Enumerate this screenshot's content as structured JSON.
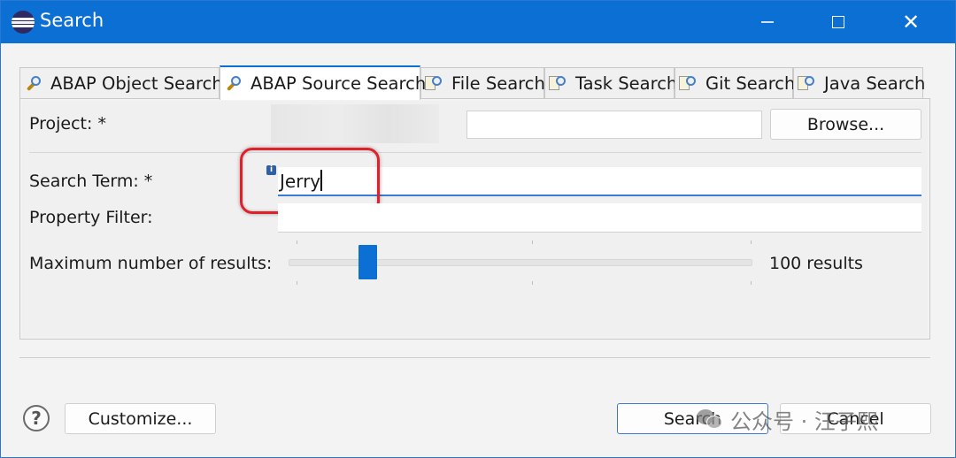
{
  "window": {
    "title": "Search",
    "close_glyph": "✕"
  },
  "tabs": [
    {
      "label": "ABAP Object Search",
      "icon": "abap-object-search-icon",
      "active": false
    },
    {
      "label": "ABAP Source Search",
      "icon": "abap-source-search-icon",
      "active": true
    },
    {
      "label": "File Search",
      "icon": "file-search-icon",
      "active": false
    },
    {
      "label": "Task Search",
      "icon": "task-search-icon",
      "active": false
    },
    {
      "label": "Git Search",
      "icon": "git-search-icon",
      "active": false
    },
    {
      "label": "Java Search",
      "icon": "java-search-icon",
      "active": false
    }
  ],
  "form": {
    "project_label": "Project: *",
    "project_value": "",
    "browse_label": "Browse...",
    "search_term_label": "Search Term: *",
    "search_term_value": "Jerry",
    "info_glyph": "i",
    "property_filter_label": "Property Filter:",
    "property_filter_value": "",
    "max_results_label": "Maximum number of results:",
    "max_results_value": 100,
    "max_results_text": "100 results"
  },
  "footer": {
    "help_glyph": "?",
    "customize_label": "Customize...",
    "search_label": "Search",
    "cancel_label": "Cancel"
  },
  "watermark": {
    "text": "公众号 · 汪子熙"
  },
  "colors": {
    "accent": "#0b6fd4",
    "highlight": "#e0212b"
  }
}
